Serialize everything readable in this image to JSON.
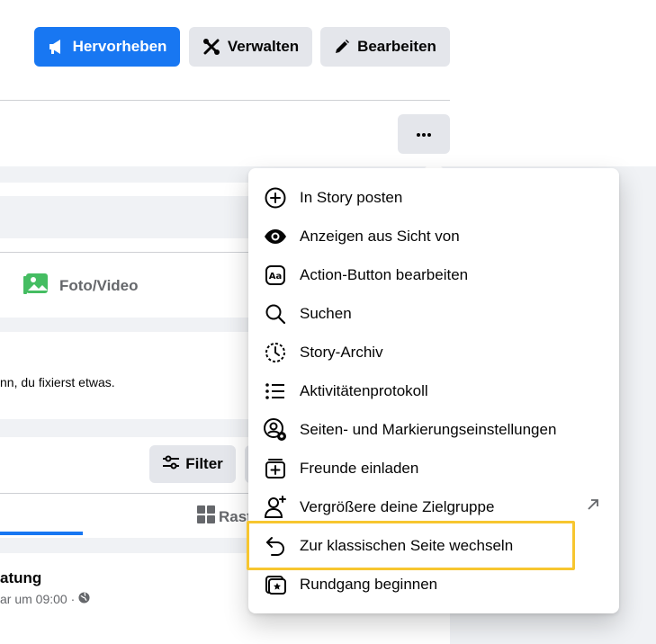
{
  "header": {
    "buttons": {
      "promote": "Hervorheben",
      "manage": "Verwalten",
      "edit": "Bearbeiten"
    },
    "more_icon": "more-horizontal-icon"
  },
  "composer": {
    "photo_video_label": "Foto/Video",
    "photo_icon_color": "#45bd62"
  },
  "status_post": {
    "text_fragment": "nn, du fixierst etwas."
  },
  "posts_toolbar": {
    "filter_label": "Filter",
    "grid_tab_fragment": "Rast"
  },
  "post": {
    "title_fragment": "atung",
    "meta_fragment": "ar um 09:00 ·"
  },
  "menu": {
    "items": [
      {
        "label": "In Story posten",
        "icon": "plus-circle-icon"
      },
      {
        "label": "Anzeigen aus Sicht von",
        "icon": "eye-icon"
      },
      {
        "label": "Action-Button bearbeiten",
        "icon": "aa-text-icon"
      },
      {
        "label": "Suchen",
        "icon": "search-icon"
      },
      {
        "label": "Story-Archiv",
        "icon": "clock-history-icon"
      },
      {
        "label": "Aktivitätenprotokoll",
        "icon": "list-icon"
      },
      {
        "label": "Seiten- und Markierungseinstellungen",
        "icon": "user-gear-icon"
      },
      {
        "label": "Freunde einladen",
        "icon": "invite-icon"
      },
      {
        "label": "Vergrößere deine Zielgruppe",
        "icon": "user-add-icon"
      },
      {
        "label": "Zur klassischen Seite wechseln",
        "icon": "undo-arrow-icon"
      },
      {
        "label": "Rundgang beginnen",
        "icon": "tour-icon"
      }
    ]
  },
  "colors": {
    "primary": "#1877f2",
    "highlight": "#f7c62f",
    "secondary_button": "#e4e6eb",
    "background": "#f0f2f5"
  }
}
